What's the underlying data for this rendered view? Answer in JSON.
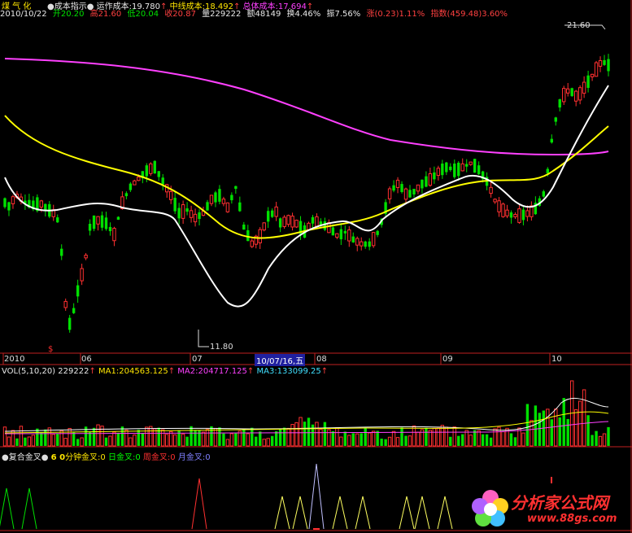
{
  "header": {
    "stock_name": "煤 气 化",
    "indicator_name": "成本指示",
    "op_cost_label": "运作成本:19.780",
    "mid_cost_label": "中线成本:18.492",
    "total_cost_label": "总体成本:17.694",
    "date": "2010/10/22",
    "open": "开20.20",
    "high": "高21.60",
    "low": "低20.04",
    "close": "收20.87",
    "volume": "量229222",
    "amount": "额48149",
    "turnover": "换4.46%",
    "amplitude": "振7.56%",
    "change": "涨(0.23)1.11%",
    "index": "指数(459.48)3.60%"
  },
  "price_panel": {
    "high_marker": "21.60",
    "low_marker": "11.80",
    "dollar_marker": "$"
  },
  "axis": {
    "labels": [
      "2010",
      "06",
      "07",
      "08",
      "09",
      "10"
    ],
    "cursor_date": "10/07/16,五"
  },
  "volume_panel": {
    "title": "VOL(5,10,20)",
    "value": "229222",
    "ma1": "MA1:204563.125",
    "ma2": "MA2:204717.125",
    "ma3": "MA3:133099.25"
  },
  "signal_panel": {
    "title": "复合金叉",
    "sixty": "6 0",
    "min60": "分钟金叉:0",
    "day": "日金叉:0",
    "week": "周金叉:0",
    "month": "月金叉:0"
  },
  "watermark": {
    "title": "分析家公式网",
    "url": "www.88gs.com"
  },
  "colors": {
    "up": "#ff3030",
    "down": "#00e000",
    "ma_white": "#ffffff",
    "ma_yellow": "#ffff00",
    "ma_magenta": "#ff40ff",
    "axis": "#c02020"
  }
}
